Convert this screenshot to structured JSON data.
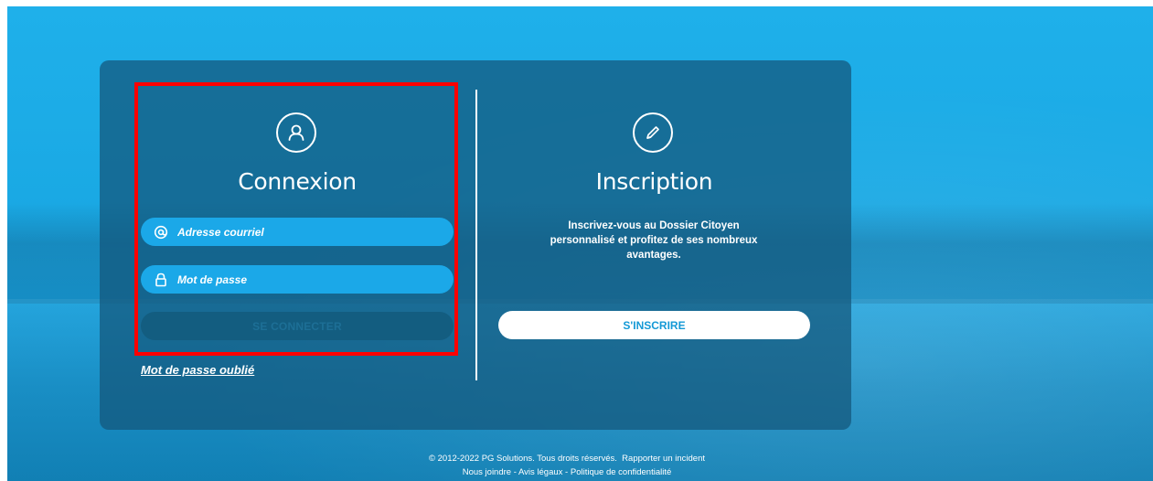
{
  "login": {
    "title": "Connexion",
    "email_placeholder": "Adresse courriel",
    "password_placeholder": "Mot de passe",
    "submit_label": "SE CONNECTER",
    "forgot_label": "Mot de passe oublié",
    "icon": "user-icon"
  },
  "signup": {
    "title": "Inscription",
    "description": "Inscrivez-vous au Dossier Citoyen personnalisé et profitez de ses nombreux avantages.",
    "button_label": "S'INSCRIRE",
    "icon": "pencil-icon"
  },
  "footer": {
    "copyright": "© 2012-2022 PG Solutions. Tous droits réservés.",
    "report_label": "Rapporter un incident",
    "contact_label": "Nous joindre",
    "sep1": " - ",
    "legal_label": "Avis légaux",
    "sep2": " - ",
    "privacy_label": "Politique de confidentialité"
  },
  "colors": {
    "background": "#1ba8e4",
    "panel": "#14567a",
    "field": "#1ba8e8",
    "highlight": "#ff0000"
  }
}
